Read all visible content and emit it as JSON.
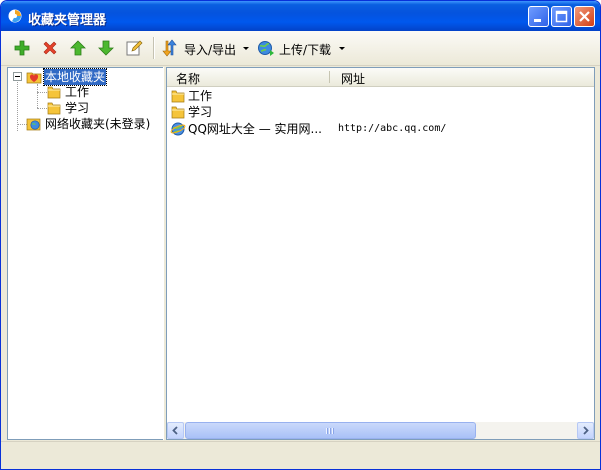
{
  "window": {
    "title": "收藏夹管理器",
    "controls": [
      "minimize-button",
      "maximize-button",
      "close-button"
    ]
  },
  "toolbar": {
    "add_icon": "plus-icon",
    "delete_icon": "x-icon",
    "up_icon": "arrow-up-icon",
    "down_icon": "arrow-down-icon",
    "edit_icon": "edit-icon",
    "import_export_label": "导入/导出",
    "upload_download_label": "上传/下载"
  },
  "tree": {
    "root_label": "本地收藏夹",
    "children": [
      {
        "label": "工作"
      },
      {
        "label": "学习"
      }
    ],
    "network_label": "网络收藏夹(未登录)"
  },
  "list": {
    "columns": {
      "name": "名称",
      "url": "网址"
    },
    "rows": [
      {
        "name": "工作",
        "url": "",
        "icon": "folder-icon"
      },
      {
        "name": "学习",
        "url": "",
        "icon": "folder-icon"
      },
      {
        "name": "QQ网址大全 — 实用网...",
        "url": "http://abc.qq.com/",
        "icon": "ie-globe-icon"
      }
    ]
  },
  "colors": {
    "titlebar": "#0553de",
    "selection": "#316ac5",
    "window_bg": "#ece9d8",
    "folder": "#f5c43a"
  }
}
